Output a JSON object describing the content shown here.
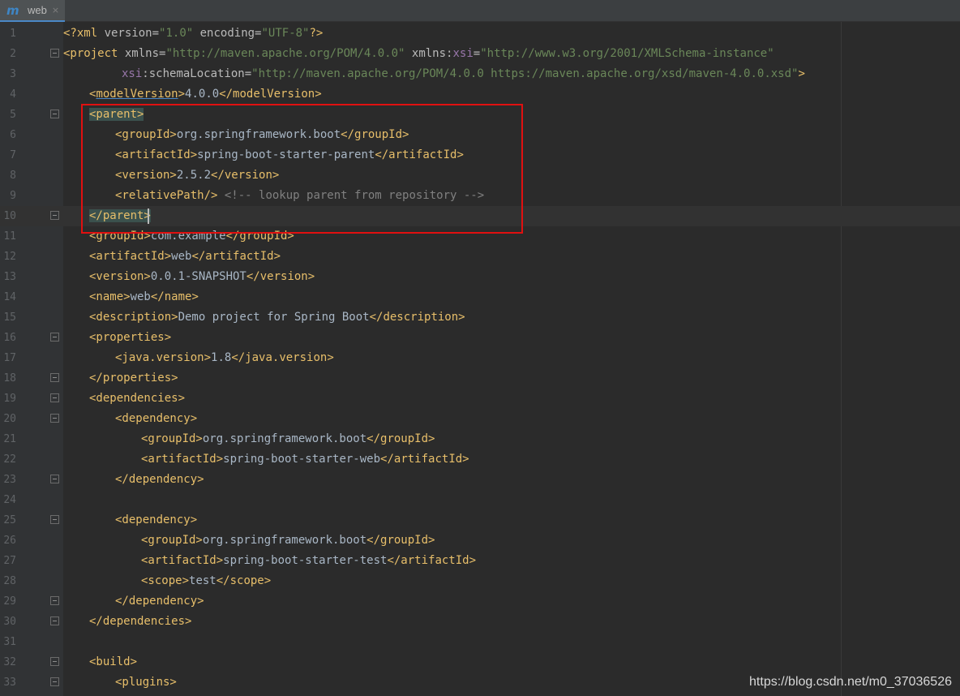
{
  "tab": {
    "icon": "maven-m-icon",
    "icon_glyph": "m",
    "label": "web",
    "close_glyph": "×"
  },
  "editor": {
    "current_line": 10,
    "lines": [
      {
        "num": "1",
        "fold": false,
        "indent": 0,
        "tokens": [
          {
            "t": "tag",
            "s": "<?xml "
          },
          {
            "t": "attr",
            "s": "version"
          },
          {
            "t": "attr",
            "s": "="
          },
          {
            "t": "val",
            "s": "\"1.0\""
          },
          {
            "t": "attr",
            "s": " encoding"
          },
          {
            "t": "attr",
            "s": "="
          },
          {
            "t": "val",
            "s": "\"UTF-8\""
          },
          {
            "t": "tag",
            "s": "?>"
          }
        ]
      },
      {
        "num": "2",
        "fold": true,
        "indent": 0,
        "tokens": [
          {
            "t": "tag",
            "s": "<project "
          },
          {
            "t": "attr",
            "s": "xmlns"
          },
          {
            "t": "attr",
            "s": "="
          },
          {
            "t": "val",
            "s": "\"http://maven.apache.org/POM/4.0.0\""
          },
          {
            "t": "attr",
            "s": " xmlns:"
          },
          {
            "t": "ns",
            "s": "xsi"
          },
          {
            "t": "attr",
            "s": "="
          },
          {
            "t": "val",
            "s": "\"http://www.w3.org/2001/XMLSchema-instance\""
          }
        ]
      },
      {
        "num": "3",
        "fold": false,
        "indent": 9,
        "tokens": [
          {
            "t": "ns",
            "s": "xsi"
          },
          {
            "t": "attr",
            "s": ":schemaLocation"
          },
          {
            "t": "attr",
            "s": "="
          },
          {
            "t": "val",
            "s": "\"http://maven.apache.org/POM/4.0.0 https://maven.apache.org/xsd/maven-4.0.0.xsd\""
          },
          {
            "t": "tag",
            "s": ">"
          }
        ]
      },
      {
        "num": "4",
        "fold": false,
        "indent": 4,
        "tokens": [
          {
            "t": "tag",
            "s": "<"
          },
          {
            "t": "link",
            "s": "modelVersion"
          },
          {
            "t": "tag",
            "s": ">"
          },
          {
            "t": "text",
            "s": "4.0.0"
          },
          {
            "t": "tag",
            "s": "</modelVersion>"
          }
        ]
      },
      {
        "num": "5",
        "fold": true,
        "indent": 4,
        "tokens": [
          {
            "t": "match",
            "s": "<parent>"
          }
        ]
      },
      {
        "num": "6",
        "fold": false,
        "indent": 8,
        "tokens": [
          {
            "t": "tag",
            "s": "<groupId>"
          },
          {
            "t": "text",
            "s": "org.springframework.boot"
          },
          {
            "t": "tag",
            "s": "</groupId>"
          }
        ]
      },
      {
        "num": "7",
        "fold": false,
        "indent": 8,
        "tokens": [
          {
            "t": "tag",
            "s": "<artifactId>"
          },
          {
            "t": "text",
            "s": "spring-boot-starter-parent"
          },
          {
            "t": "tag",
            "s": "</artifactId>"
          }
        ]
      },
      {
        "num": "8",
        "fold": false,
        "indent": 8,
        "tokens": [
          {
            "t": "tag",
            "s": "<version>"
          },
          {
            "t": "text",
            "s": "2.5.2"
          },
          {
            "t": "tag",
            "s": "</version>"
          }
        ]
      },
      {
        "num": "9",
        "fold": false,
        "indent": 8,
        "tokens": [
          {
            "t": "tag",
            "s": "<relativePath/>"
          },
          {
            "t": "comment",
            "s": " <!-- lookup parent from repository -->"
          }
        ]
      },
      {
        "num": "10",
        "fold": true,
        "indent": 4,
        "caret": true,
        "tokens": [
          {
            "t": "match",
            "s": "</parent>"
          }
        ]
      },
      {
        "num": "11",
        "fold": false,
        "indent": 4,
        "tokens": [
          {
            "t": "tag",
            "s": "<groupId>"
          },
          {
            "t": "text",
            "s": "com.example"
          },
          {
            "t": "tag",
            "s": "</groupId>"
          }
        ]
      },
      {
        "num": "12",
        "fold": false,
        "indent": 4,
        "tokens": [
          {
            "t": "tag",
            "s": "<artifactId>"
          },
          {
            "t": "text",
            "s": "web"
          },
          {
            "t": "tag",
            "s": "</artifactId>"
          }
        ]
      },
      {
        "num": "13",
        "fold": false,
        "indent": 4,
        "tokens": [
          {
            "t": "tag",
            "s": "<version>"
          },
          {
            "t": "text",
            "s": "0.0.1-SNAPSHOT"
          },
          {
            "t": "tag",
            "s": "</version>"
          }
        ]
      },
      {
        "num": "14",
        "fold": false,
        "indent": 4,
        "tokens": [
          {
            "t": "tag",
            "s": "<name>"
          },
          {
            "t": "text",
            "s": "web"
          },
          {
            "t": "tag",
            "s": "</name>"
          }
        ]
      },
      {
        "num": "15",
        "fold": false,
        "indent": 4,
        "tokens": [
          {
            "t": "tag",
            "s": "<description>"
          },
          {
            "t": "text",
            "s": "Demo project for Spring Boot"
          },
          {
            "t": "tag",
            "s": "</description>"
          }
        ]
      },
      {
        "num": "16",
        "fold": true,
        "indent": 4,
        "tokens": [
          {
            "t": "tag",
            "s": "<properties>"
          }
        ]
      },
      {
        "num": "17",
        "fold": false,
        "indent": 8,
        "tokens": [
          {
            "t": "tag",
            "s": "<java.version>"
          },
          {
            "t": "text",
            "s": "1.8"
          },
          {
            "t": "tag",
            "s": "</java.version>"
          }
        ]
      },
      {
        "num": "18",
        "fold": true,
        "indent": 4,
        "tokens": [
          {
            "t": "tag",
            "s": "</properties>"
          }
        ]
      },
      {
        "num": "19",
        "fold": true,
        "indent": 4,
        "tokens": [
          {
            "t": "tag",
            "s": "<dependencies>"
          }
        ]
      },
      {
        "num": "20",
        "fold": true,
        "indent": 8,
        "tokens": [
          {
            "t": "tag",
            "s": "<dependency>"
          }
        ]
      },
      {
        "num": "21",
        "fold": false,
        "indent": 12,
        "tokens": [
          {
            "t": "tag",
            "s": "<groupId>"
          },
          {
            "t": "text",
            "s": "org.springframework.boot"
          },
          {
            "t": "tag",
            "s": "</groupId>"
          }
        ]
      },
      {
        "num": "22",
        "fold": false,
        "indent": 12,
        "tokens": [
          {
            "t": "tag",
            "s": "<artifactId>"
          },
          {
            "t": "text",
            "s": "spring-boot-starter-web"
          },
          {
            "t": "tag",
            "s": "</artifactId>"
          }
        ]
      },
      {
        "num": "23",
        "fold": true,
        "indent": 8,
        "tokens": [
          {
            "t": "tag",
            "s": "</dependency>"
          }
        ]
      },
      {
        "num": "24",
        "fold": false,
        "indent": 0,
        "tokens": []
      },
      {
        "num": "25",
        "fold": true,
        "indent": 8,
        "tokens": [
          {
            "t": "tag",
            "s": "<dependency>"
          }
        ]
      },
      {
        "num": "26",
        "fold": false,
        "indent": 12,
        "tokens": [
          {
            "t": "tag",
            "s": "<groupId>"
          },
          {
            "t": "text",
            "s": "org.springframework.boot"
          },
          {
            "t": "tag",
            "s": "</groupId>"
          }
        ]
      },
      {
        "num": "27",
        "fold": false,
        "indent": 12,
        "tokens": [
          {
            "t": "tag",
            "s": "<artifactId>"
          },
          {
            "t": "text",
            "s": "spring-boot-starter-test"
          },
          {
            "t": "tag",
            "s": "</artifactId>"
          }
        ]
      },
      {
        "num": "28",
        "fold": false,
        "indent": 12,
        "tokens": [
          {
            "t": "tag",
            "s": "<scope>"
          },
          {
            "t": "text",
            "s": "test"
          },
          {
            "t": "tag",
            "s": "</scope>"
          }
        ]
      },
      {
        "num": "29",
        "fold": true,
        "indent": 8,
        "tokens": [
          {
            "t": "tag",
            "s": "</dependency>"
          }
        ]
      },
      {
        "num": "30",
        "fold": true,
        "indent": 4,
        "tokens": [
          {
            "t": "tag",
            "s": "</dependencies>"
          }
        ]
      },
      {
        "num": "31",
        "fold": false,
        "indent": 0,
        "tokens": []
      },
      {
        "num": "32",
        "fold": true,
        "indent": 4,
        "tokens": [
          {
            "t": "tag",
            "s": "<build>"
          }
        ]
      },
      {
        "num": "33",
        "fold": true,
        "indent": 8,
        "tokens": [
          {
            "t": "tag",
            "s": "<plugins>"
          }
        ]
      }
    ]
  },
  "watermark": "https://blog.csdn.net/m0_37036526",
  "colors": {
    "background": "#2b2b2b",
    "tag": "#e8bf6a",
    "attribute_value": "#6a8759",
    "namespace": "#9876aa",
    "comment": "#808080",
    "highlight_box": "#e01010"
  }
}
